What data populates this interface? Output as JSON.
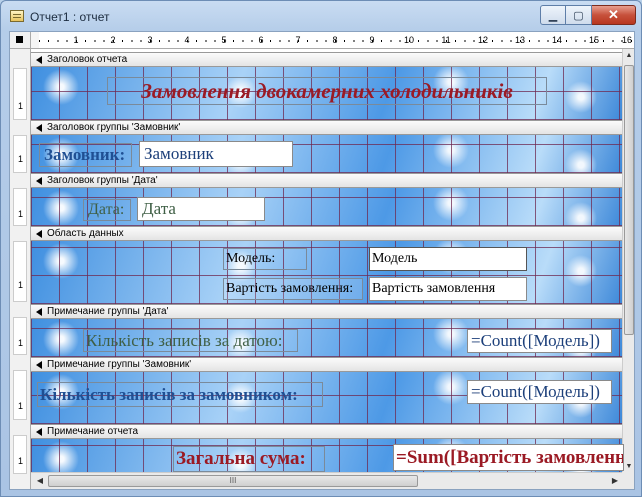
{
  "window": {
    "title": "Отчет1 : отчет",
    "min_glyph": "▁",
    "max_glyph": "▢",
    "close_glyph": "✕"
  },
  "ruler": {
    "ticks": [
      "1",
      "2",
      "3",
      "4",
      "5",
      "6",
      "7",
      "8",
      "9",
      "10",
      "11",
      "12",
      "13",
      "14",
      "15",
      "16"
    ],
    "vertical": [
      "1",
      "1",
      "1",
      "1",
      "1",
      "1",
      "1"
    ]
  },
  "sections": [
    {
      "label": "Заголовок отчета"
    },
    {
      "label": "Заголовок группы 'Замовник'"
    },
    {
      "label": "Заголовок группы 'Дата'"
    },
    {
      "label": "Область данных"
    },
    {
      "label": "Примечание группы 'Дата'"
    },
    {
      "label": "Примечание группы 'Замовник'"
    },
    {
      "label": "Примечание отчета"
    }
  ],
  "controls": {
    "report_title": "Замовлення двокамерних холодильників",
    "customer_label": "Замовник:",
    "customer_field": "Замовник",
    "date_label": "Дата:",
    "date_field": "Дата",
    "model_label": "Модель:",
    "model_field": "Модель",
    "cost_label": "Вартість замовлення:",
    "cost_field": "Вартість замовлення",
    "count_by_date_label": "Кількість записів за датою:",
    "count_by_date_expr": "=Count([Модель])",
    "count_by_customer_label": "Кількість записів за замовником:",
    "count_by_customer_expr": "=Count([Модель])",
    "total_label": "Загальна сума:",
    "total_expr": "=Sum([Вартість замовлення])"
  },
  "scrollbar": {
    "up": "▲",
    "down": "▼",
    "left": "◀",
    "right": "▶",
    "grip": "III"
  },
  "colors": {
    "title_red": "#9b1a24",
    "label_blue": "#1f4f93",
    "label_green": "#3f5f45",
    "expr_blue": "#1c3f7a"
  }
}
